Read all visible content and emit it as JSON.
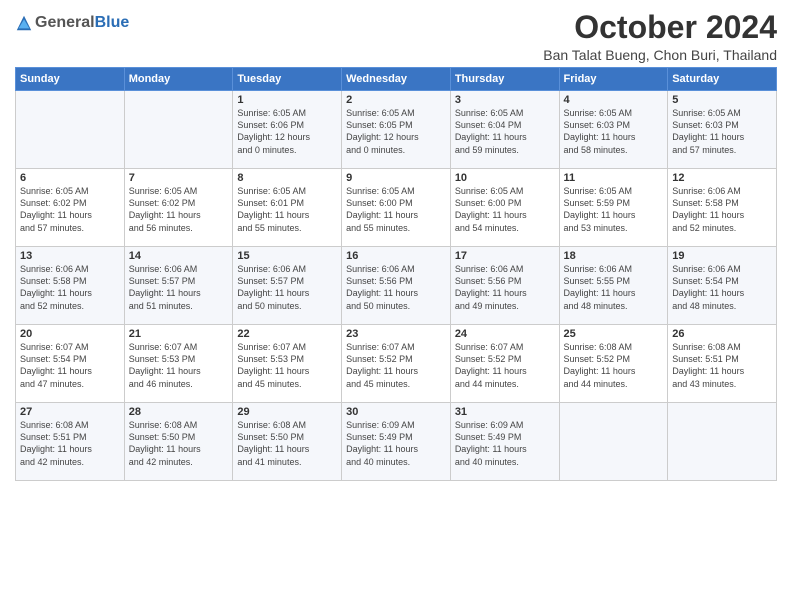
{
  "logo": {
    "general": "General",
    "blue": "Blue"
  },
  "title": "October 2024",
  "location": "Ban Talat Bueng, Chon Buri, Thailand",
  "days_of_week": [
    "Sunday",
    "Monday",
    "Tuesday",
    "Wednesday",
    "Thursday",
    "Friday",
    "Saturday"
  ],
  "weeks": [
    [
      {
        "day": "",
        "info": ""
      },
      {
        "day": "",
        "info": ""
      },
      {
        "day": "1",
        "info": "Sunrise: 6:05 AM\nSunset: 6:06 PM\nDaylight: 12 hours\nand 0 minutes."
      },
      {
        "day": "2",
        "info": "Sunrise: 6:05 AM\nSunset: 6:05 PM\nDaylight: 12 hours\nand 0 minutes."
      },
      {
        "day": "3",
        "info": "Sunrise: 6:05 AM\nSunset: 6:04 PM\nDaylight: 11 hours\nand 59 minutes."
      },
      {
        "day": "4",
        "info": "Sunrise: 6:05 AM\nSunset: 6:03 PM\nDaylight: 11 hours\nand 58 minutes."
      },
      {
        "day": "5",
        "info": "Sunrise: 6:05 AM\nSunset: 6:03 PM\nDaylight: 11 hours\nand 57 minutes."
      }
    ],
    [
      {
        "day": "6",
        "info": "Sunrise: 6:05 AM\nSunset: 6:02 PM\nDaylight: 11 hours\nand 57 minutes."
      },
      {
        "day": "7",
        "info": "Sunrise: 6:05 AM\nSunset: 6:02 PM\nDaylight: 11 hours\nand 56 minutes."
      },
      {
        "day": "8",
        "info": "Sunrise: 6:05 AM\nSunset: 6:01 PM\nDaylight: 11 hours\nand 55 minutes."
      },
      {
        "day": "9",
        "info": "Sunrise: 6:05 AM\nSunset: 6:00 PM\nDaylight: 11 hours\nand 55 minutes."
      },
      {
        "day": "10",
        "info": "Sunrise: 6:05 AM\nSunset: 6:00 PM\nDaylight: 11 hours\nand 54 minutes."
      },
      {
        "day": "11",
        "info": "Sunrise: 6:05 AM\nSunset: 5:59 PM\nDaylight: 11 hours\nand 53 minutes."
      },
      {
        "day": "12",
        "info": "Sunrise: 6:06 AM\nSunset: 5:58 PM\nDaylight: 11 hours\nand 52 minutes."
      }
    ],
    [
      {
        "day": "13",
        "info": "Sunrise: 6:06 AM\nSunset: 5:58 PM\nDaylight: 11 hours\nand 52 minutes."
      },
      {
        "day": "14",
        "info": "Sunrise: 6:06 AM\nSunset: 5:57 PM\nDaylight: 11 hours\nand 51 minutes."
      },
      {
        "day": "15",
        "info": "Sunrise: 6:06 AM\nSunset: 5:57 PM\nDaylight: 11 hours\nand 50 minutes."
      },
      {
        "day": "16",
        "info": "Sunrise: 6:06 AM\nSunset: 5:56 PM\nDaylight: 11 hours\nand 50 minutes."
      },
      {
        "day": "17",
        "info": "Sunrise: 6:06 AM\nSunset: 5:56 PM\nDaylight: 11 hours\nand 49 minutes."
      },
      {
        "day": "18",
        "info": "Sunrise: 6:06 AM\nSunset: 5:55 PM\nDaylight: 11 hours\nand 48 minutes."
      },
      {
        "day": "19",
        "info": "Sunrise: 6:06 AM\nSunset: 5:54 PM\nDaylight: 11 hours\nand 48 minutes."
      }
    ],
    [
      {
        "day": "20",
        "info": "Sunrise: 6:07 AM\nSunset: 5:54 PM\nDaylight: 11 hours\nand 47 minutes."
      },
      {
        "day": "21",
        "info": "Sunrise: 6:07 AM\nSunset: 5:53 PM\nDaylight: 11 hours\nand 46 minutes."
      },
      {
        "day": "22",
        "info": "Sunrise: 6:07 AM\nSunset: 5:53 PM\nDaylight: 11 hours\nand 45 minutes."
      },
      {
        "day": "23",
        "info": "Sunrise: 6:07 AM\nSunset: 5:52 PM\nDaylight: 11 hours\nand 45 minutes."
      },
      {
        "day": "24",
        "info": "Sunrise: 6:07 AM\nSunset: 5:52 PM\nDaylight: 11 hours\nand 44 minutes."
      },
      {
        "day": "25",
        "info": "Sunrise: 6:08 AM\nSunset: 5:52 PM\nDaylight: 11 hours\nand 44 minutes."
      },
      {
        "day": "26",
        "info": "Sunrise: 6:08 AM\nSunset: 5:51 PM\nDaylight: 11 hours\nand 43 minutes."
      }
    ],
    [
      {
        "day": "27",
        "info": "Sunrise: 6:08 AM\nSunset: 5:51 PM\nDaylight: 11 hours\nand 42 minutes."
      },
      {
        "day": "28",
        "info": "Sunrise: 6:08 AM\nSunset: 5:50 PM\nDaylight: 11 hours\nand 42 minutes."
      },
      {
        "day": "29",
        "info": "Sunrise: 6:08 AM\nSunset: 5:50 PM\nDaylight: 11 hours\nand 41 minutes."
      },
      {
        "day": "30",
        "info": "Sunrise: 6:09 AM\nSunset: 5:49 PM\nDaylight: 11 hours\nand 40 minutes."
      },
      {
        "day": "31",
        "info": "Sunrise: 6:09 AM\nSunset: 5:49 PM\nDaylight: 11 hours\nand 40 minutes."
      },
      {
        "day": "",
        "info": ""
      },
      {
        "day": "",
        "info": ""
      }
    ]
  ]
}
